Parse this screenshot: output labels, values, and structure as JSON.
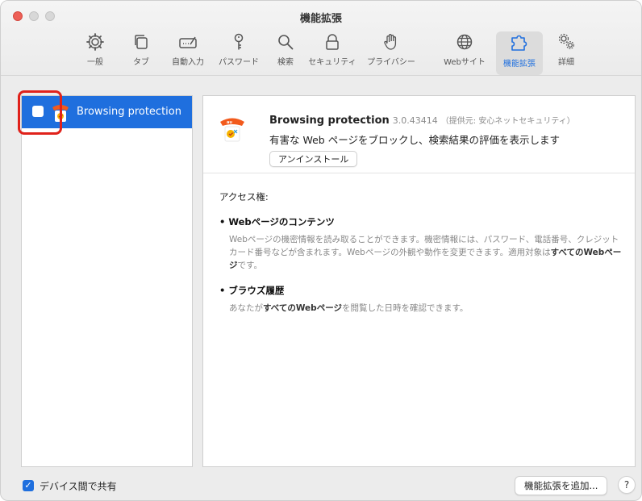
{
  "window": {
    "title": "機能拡張"
  },
  "tabs": [
    {
      "label": "一般",
      "icon": "gear-icon"
    },
    {
      "label": "タブ",
      "icon": "tabs-icon"
    },
    {
      "label": "自動入力",
      "icon": "autofill-icon"
    },
    {
      "label": "パスワード",
      "icon": "key-icon"
    },
    {
      "label": "検索",
      "icon": "search-icon"
    },
    {
      "label": "セキュリティ",
      "icon": "lock-icon"
    },
    {
      "label": "プライバシー",
      "icon": "hand-icon"
    },
    {
      "label": "Webサイト",
      "icon": "globe-icon"
    },
    {
      "label": "機能拡張",
      "icon": "puzzle-icon",
      "active": true
    },
    {
      "label": "詳細",
      "icon": "gears-icon"
    }
  ],
  "extension_list": [
    {
      "name": "Browsing protection",
      "enabled": false,
      "selected": true
    }
  ],
  "detail": {
    "name": "Browsing protection",
    "version": "3.0.43414",
    "provider": "（提供元: 安心ネットセキュリティ）",
    "description": "有害な Web ページをブロックし、検索結果の評価を表示します",
    "uninstall_label": "アンインストール",
    "permissions_heading": "アクセス権:",
    "permissions": [
      {
        "title": "Webページのコンテンツ",
        "text_pre": "Webページの機密情報を読み取ることができます。機密情報には、パスワード、電話番号、クレジットカード番号などが含まれます。Webページの外観や動作を変更できます。適用対象は",
        "text_bold": "すべてのWebページ",
        "text_post": "です。"
      },
      {
        "title": "ブラウズ履歴",
        "text_pre": "あなたが",
        "text_bold": "すべてのWebページ",
        "text_post": "を閲覧した日時を確認できます。"
      }
    ]
  },
  "footer": {
    "share_label": "デバイス間で共有",
    "share_checked": true,
    "add_extension_label": "機能拡張を追加...",
    "help_label": "?"
  },
  "colors": {
    "accent": "#1f6fde",
    "highlight": "#e0221b",
    "brand_orange": "#f25a1c"
  }
}
